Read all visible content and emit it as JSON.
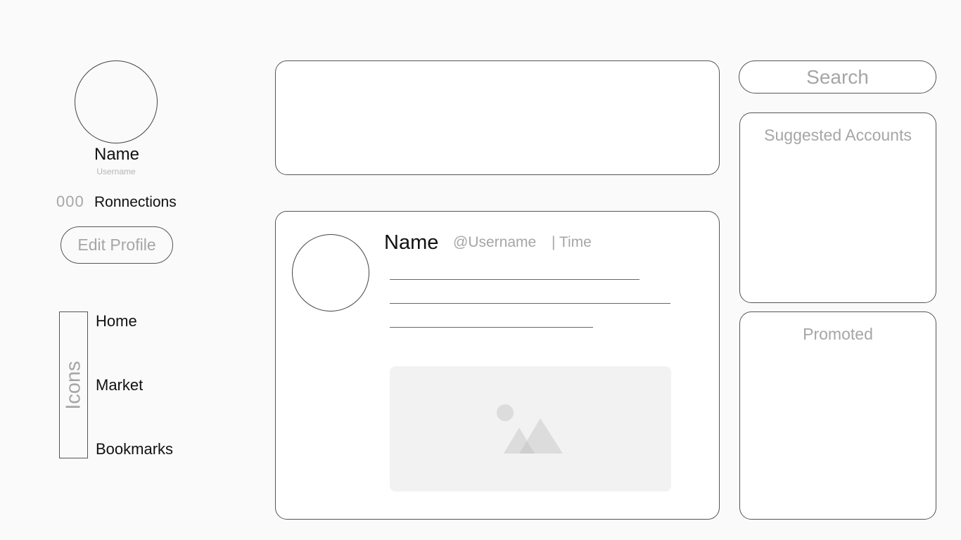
{
  "profile": {
    "name": "Name",
    "username": "Username",
    "connections_count": "000",
    "connections_label": "Ronnections",
    "edit_button_label": "Edit Profile"
  },
  "nav": {
    "icons_placeholder": "Icons",
    "items": [
      {
        "label": "Home"
      },
      {
        "label": "Market"
      },
      {
        "label": "Bookmarks"
      }
    ]
  },
  "post": {
    "name": "Name",
    "username": "@Username",
    "time": "| Time"
  },
  "sidebar": {
    "search_placeholder": "Search",
    "suggested_title": "Suggested Accounts",
    "promoted_title": "Promoted"
  },
  "colors": {
    "background": "#fafafa",
    "border": "#555555",
    "muted_text": "#a6a6a6",
    "primary_text": "#111111",
    "image_placeholder_bg": "#f2f2f2",
    "image_placeholder_shape": "#dcdcdc"
  }
}
